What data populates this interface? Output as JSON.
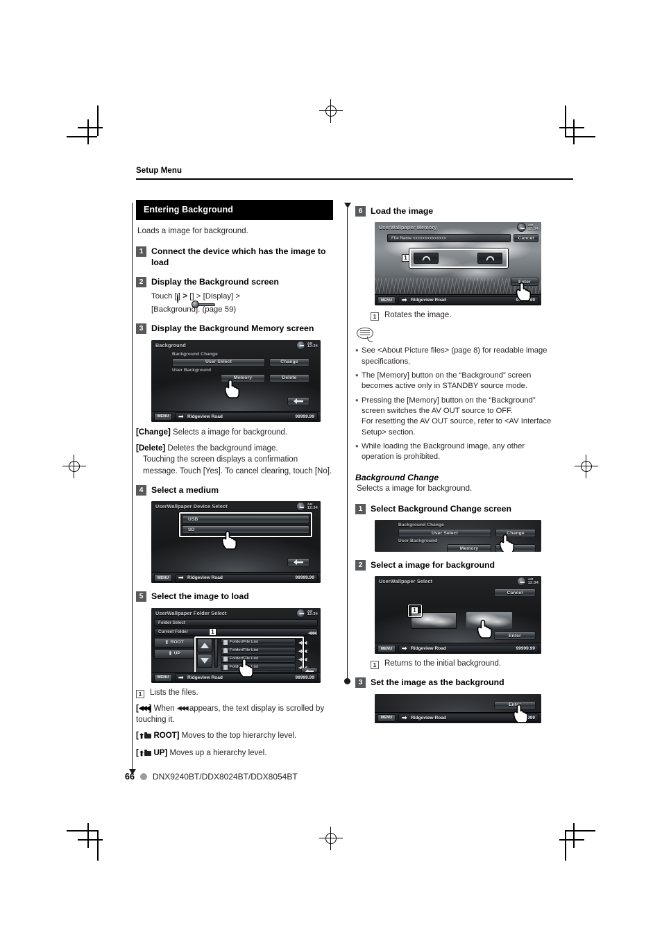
{
  "header": {
    "title": "Setup Menu"
  },
  "footer": {
    "page": "66",
    "models": "DNX9240BT/DDX8024BT/DDX8054BT"
  },
  "left": {
    "band": "Entering Background",
    "lead": "Loads a image for background.",
    "step1": {
      "num": "1",
      "text": "Connect the device which has the image to load"
    },
    "step2": {
      "num": "2",
      "text": "Display the Background screen",
      "touch_prefix": "Touch [",
      "touch_mid1": "] ",
      "gt": ">",
      "touch_mid2": " [",
      "touch_display": "] > [Display] >",
      "touch_tail": "[Background]. (page 59)"
    },
    "step3": {
      "num": "3",
      "text": "Display the Background Memory screen"
    },
    "def_change_key": "[Change]",
    "def_change_txt": "Selects a image for background.",
    "def_delete_key": "[Delete]",
    "def_delete_txt": "Deletes the background image.",
    "def_delete_more": "Touching the screen displays a confirmation message. Touch [Yes]. To cancel clearing, touch [No].",
    "step4": {
      "num": "4",
      "text": "Select a medium"
    },
    "step5": {
      "num": "5",
      "text": "Select the image to load"
    },
    "note1_num": "1",
    "note1_txt": "Lists the files.",
    "note_rew_key_open": "[",
    "note_rew_key_close": "]",
    "note_rew_txt_a": "When",
    "note_rew_txt_b": "appears, the text display is scrolled by touching it.",
    "note_root_key": "ROOT]",
    "note_root_txt": "Moves to the top hierarchy level.",
    "note_up_key": "UP]",
    "note_up_txt": "Moves up a hierarchy level."
  },
  "right": {
    "step6": {
      "num": "6",
      "text": "Load the image"
    },
    "note6_num": "1",
    "note6_txt": "Rotates the image.",
    "notes": [
      "See <About Picture files> (page 8) for readable image specifications.",
      "The [Memory] button on the “Background” screen becomes active only in STANDBY source mode.",
      "Pressing the [Memory] button on the “Background” screen switches the AV OUT source to OFF.",
      "While loading the Background image, any other operation is prohibited."
    ],
    "note3_cont": "For resetting the AV OUT source, refer to <AV Interface Setup> section.",
    "section_title": "Background Change",
    "section_lead": "Selects a image for background.",
    "bstep1": {
      "num": "1",
      "text": "Select Background Change screen"
    },
    "bstep2": {
      "num": "2",
      "text": "Select a image for background"
    },
    "bnote_num": "1",
    "bnote_txt": "Returns to the initial background.",
    "bstep3": {
      "num": "3",
      "text": "Set the image as the background"
    }
  },
  "screens": {
    "background": {
      "title": "Background",
      "group_label": "Background Change",
      "user_select": "User Select",
      "change": "Change",
      "user_background": "User Background",
      "memory": "Memory",
      "delete": "Delete",
      "clock": "12:34",
      "ampm": "AM",
      "menu": "MENU",
      "route": "Ridgeview Road",
      "dist": "99999.99"
    },
    "device_select": {
      "title": "UserWallpaper Device Select",
      "usb": "USB",
      "sd": "SD",
      "clock": "12:34",
      "ampm": "AM",
      "menu": "MENU",
      "route": "Ridgeview Road",
      "dist": "99999.99"
    },
    "folder_select": {
      "title": "UserWallpaper Folder Select",
      "folder_select": "Folder Select",
      "current_folder": "Current Folder",
      "root": "ROOT",
      "up": "UP",
      "item": "Folder/File List",
      "items": [
        "Folder/File List",
        "Folder/File List",
        "Folder/File List",
        "Folder/File List",
        "Folder/File List"
      ],
      "callout": "1",
      "clock": "12:34",
      "ampm": "AM",
      "menu": "MENU",
      "route": "Ridgeview Road",
      "dist": "99999.99"
    },
    "memory": {
      "title": "UserWallpaper Memory",
      "file_name": "File Name xxxxxxxxxxxxxx",
      "cancel": "Cancel",
      "enter": "Enter",
      "callout": "1",
      "clock": "12:34",
      "ampm": "AM",
      "menu": "MENU",
      "route": "Ridgeview Road",
      "dist": "99999.99"
    },
    "bg_change_crop": {
      "group_label": "Background Change",
      "user_select": "User Select",
      "change": "Change",
      "user_background": "User Background",
      "memory": "Memory"
    },
    "wallpaper_select": {
      "title": "UserWallpaper Select",
      "cancel": "Cancel",
      "enter": "Enter",
      "callout": "1",
      "clock": "12:34",
      "ampm": "AM",
      "menu": "MENU",
      "route": "Ridgeview Road",
      "dist": "99999.99"
    },
    "enter_crop": {
      "enter": "Enter",
      "menu": "MENU",
      "route": "Ridgeview Road",
      "dist": "9999"
    }
  }
}
